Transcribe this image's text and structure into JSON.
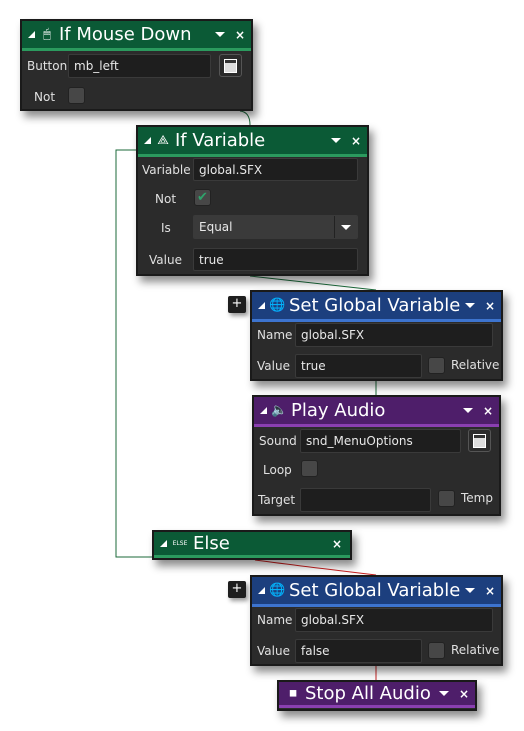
{
  "colors": {
    "green": "#0b5a36",
    "blue": "#1c3f7e",
    "purple": "#4e1e6a",
    "body": "#2b2b2b"
  },
  "mouse_down": {
    "title": "If Mouse Down",
    "button_label": "Button",
    "button_value": "mb_left",
    "not_label": "Not",
    "not_checked": false
  },
  "if_variable": {
    "title": "If Variable",
    "variable_label": "Variable",
    "variable_value": "global.SFX",
    "not_label": "Not",
    "not_checked": true,
    "is_label": "Is",
    "is_value": "Equal",
    "value_label": "Value",
    "value_value": "true"
  },
  "set_global_1": {
    "title": "Set Global Variable",
    "name_label": "Name",
    "name_value": "global.SFX",
    "value_label": "Value",
    "value_value": "true",
    "relative_label": "Relative",
    "relative_checked": false
  },
  "play_audio": {
    "title": "Play Audio",
    "sound_label": "Sound",
    "sound_value": "snd_MenuOptions",
    "loop_label": "Loop",
    "loop_checked": false,
    "target_label": "Target",
    "target_value": "",
    "temp_label": "Temp",
    "temp_checked": false
  },
  "else_block": {
    "title": "Else",
    "icon_text": "ELSE"
  },
  "set_global_2": {
    "title": "Set Global Variable",
    "name_label": "Name",
    "name_value": "global.SFX",
    "value_label": "Value",
    "value_value": "false",
    "relative_label": "Relative",
    "relative_checked": false
  },
  "stop_audio": {
    "title": "Stop All Audio"
  },
  "plus_label": "+",
  "check_mark": "✔",
  "close_label": "×"
}
